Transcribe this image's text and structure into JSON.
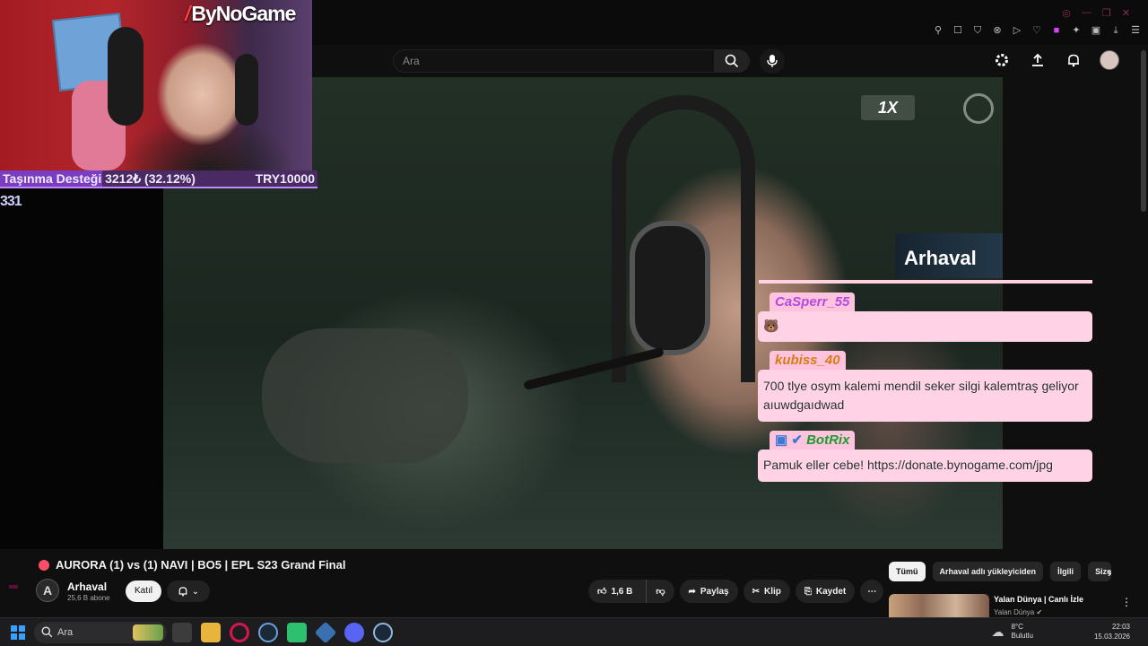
{
  "overlay": {
    "brand": "ByNoGame",
    "donation_label": "Taşınma Desteği 3212₺ (32.12%)",
    "donation_goal": "TRY10000",
    "donation_progress": 0.3212,
    "left_number": "331",
    "streamer_tag": "Arhaval"
  },
  "chat": [
    {
      "user": "CaSperr_55",
      "message": "🐻",
      "color": "#b44ae0"
    },
    {
      "user": "kubiss_40",
      "message": "700 tlye osym kalemi mendil seker silgi kalemtraş geliyor aıuwdgaıdwad",
      "color": "#d97b14"
    },
    {
      "user": "BotRix",
      "message": "Pamuk eller cebe! https://donate.bynogame.com/jpg",
      "color": "#1e9b2e"
    }
  ],
  "search": {
    "placeholder": "Ara"
  },
  "video": {
    "title": "AURORA (1) vs (1) NAVI | BO5 | EPL S23 Grand Final",
    "channel": "Arhaval",
    "channel_initial": "A",
    "subscribers": "25,6 B abone",
    "join_label": "Katıl",
    "likes": "1,6 B",
    "share_label": "Paylaş",
    "clip_label": "Klip",
    "save_label": "Kaydet",
    "logo_text": "1X"
  },
  "chips": [
    "Tümü",
    "Arhaval adlı yükleyiciden",
    "İlgili",
    "Size"
  ],
  "recommendation": {
    "title": "Yalan Dünya | Canlı İzle",
    "channel": "Yalan Dünya"
  },
  "taskbar": {
    "search_label": "Ara",
    "temperature": "8°C",
    "weather": "Bulutlu",
    "time": "22:03",
    "date": "15.03.2026"
  },
  "colors": {
    "accent": "#ff4e6a",
    "chat_bg": "#ffd3e5",
    "donation": "#4a2a63"
  }
}
